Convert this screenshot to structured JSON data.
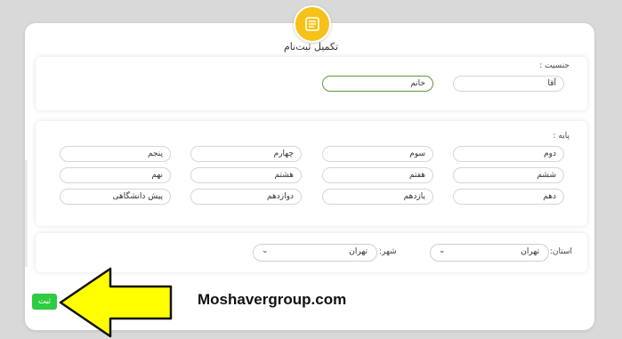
{
  "page": {
    "title": "تکمیل ثبت‌نام",
    "watermark": "Moshavergroup.com",
    "submit_label": "ثبت"
  },
  "gender": {
    "label": "جنسیت :",
    "options": [
      {
        "label": "آقا",
        "selected": false
      },
      {
        "label": "خانم",
        "selected": true
      }
    ]
  },
  "grade": {
    "label": "پایه :",
    "rows": [
      [
        "دوم",
        "سوم",
        "چهارم",
        "پنجم"
      ],
      [
        "ششم",
        "هفتم",
        "هشتم",
        "نهم"
      ],
      [
        "دهم",
        "یازدهم",
        "دوازدهم",
        "پیش دانشگاهی"
      ]
    ]
  },
  "location": {
    "province_label": "استان:",
    "province_value": "تهران",
    "city_label": "شهر:",
    "city_value": "تهران"
  },
  "colors": {
    "accent_yellow": "#f6c21a",
    "submit_green": "#2ecc40",
    "selected_border": "#5a9a3a",
    "arrow_fill": "#ffff00"
  },
  "icons": {
    "badge": "form-icon",
    "dropdown": "chevron-down-icon",
    "pointer": "arrow-left-icon"
  }
}
